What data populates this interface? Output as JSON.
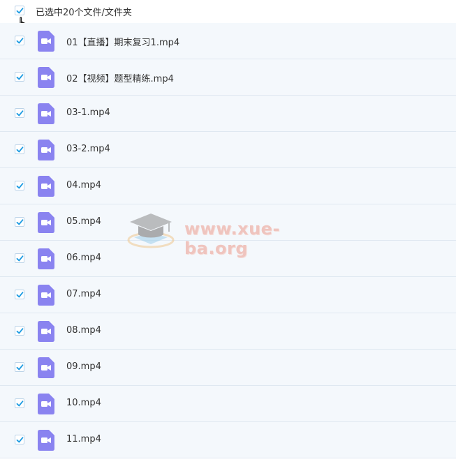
{
  "header": {
    "selected_label": "已选中20个文件/文件夹",
    "select_all_checked": true
  },
  "files": [
    {
      "name": "01【直播】期末复习1.mp4",
      "checked": true,
      "icon": "video-file-icon"
    },
    {
      "name": "02【视频】题型精练.mp4",
      "checked": true,
      "icon": "video-file-icon"
    },
    {
      "name": "03-1.mp4",
      "checked": true,
      "icon": "video-file-icon"
    },
    {
      "name": "03-2.mp4",
      "checked": true,
      "icon": "video-file-icon"
    },
    {
      "name": "04.mp4",
      "checked": true,
      "icon": "video-file-icon"
    },
    {
      "name": "05.mp4",
      "checked": true,
      "icon": "video-file-icon"
    },
    {
      "name": "06.mp4",
      "checked": true,
      "icon": "video-file-icon"
    },
    {
      "name": "07.mp4",
      "checked": true,
      "icon": "video-file-icon"
    },
    {
      "name": "08.mp4",
      "checked": true,
      "icon": "video-file-icon"
    },
    {
      "name": "09.mp4",
      "checked": true,
      "icon": "video-file-icon"
    },
    {
      "name": "10.mp4",
      "checked": true,
      "icon": "video-file-icon"
    },
    {
      "name": "11.mp4",
      "checked": true,
      "icon": "video-file-icon"
    }
  ],
  "watermark": {
    "text": "www.xue-ba.org"
  },
  "colors": {
    "check": "#1c9be2",
    "file_icon": "#8a83f0",
    "row_bg": "#f4f8fc",
    "row_border": "#dfe8f1"
  }
}
